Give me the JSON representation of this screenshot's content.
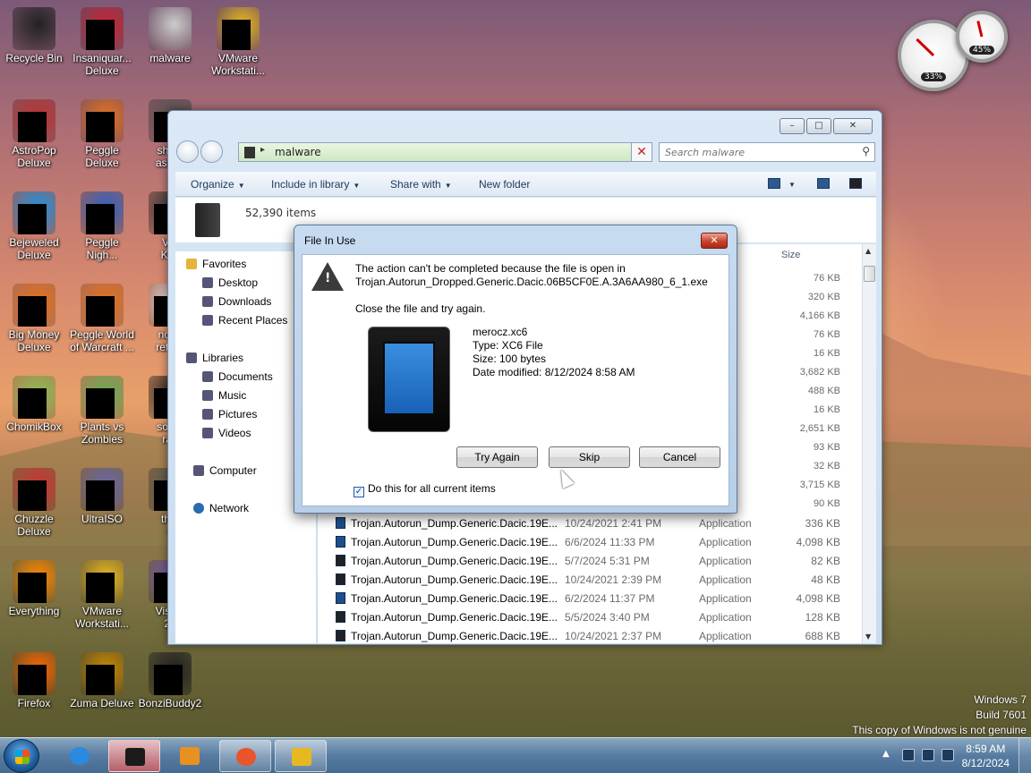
{
  "desktop": {
    "icons": [
      {
        "label": "Recycle Bin"
      },
      {
        "label": "Insaniquar...\nDeluxe"
      },
      {
        "label": "malware"
      },
      {
        "label": "VMware\nWorkstati..."
      },
      {
        "label": "AstroPop\nDeluxe"
      },
      {
        "label": "Peggle\nDeluxe"
      },
      {
        "label": "shit p\nasked"
      },
      {
        "label": "Bejeweled\nDeluxe"
      },
      {
        "label": "Peggle\nNigh..."
      },
      {
        "label": "VM\nKey"
      },
      {
        "label": "Big Money\nDeluxe"
      },
      {
        "label": "Peggle World\nof Warcraft ..."
      },
      {
        "label": "none\nretard"
      },
      {
        "label": "ChomikBox"
      },
      {
        "label": "Plants vs\nZombies"
      },
      {
        "label": "some\nran"
      },
      {
        "label": "Chuzzle\nDeluxe"
      },
      {
        "label": "UltraISO"
      },
      {
        "label": "that\nc"
      },
      {
        "label": "Everything"
      },
      {
        "label": "VMware\nWorkstati..."
      },
      {
        "label": "Visual\n20"
      },
      {
        "label": "Firefox"
      },
      {
        "label": "Zuma Deluxe"
      },
      {
        "label": "BonziBuddy2"
      }
    ]
  },
  "gadgets": {
    "cpu_label": "33%",
    "mem_label": "45%",
    "cpu": 33,
    "mem": 45
  },
  "explorer": {
    "address": "malware",
    "search_placeholder": "Search malware",
    "toolbar": {
      "organize": "Organize",
      "include": "Include in library",
      "share": "Share with",
      "new_folder": "New folder"
    },
    "item_count": "52,390 items",
    "nav": {
      "favorites": "Favorites",
      "desktop": "Desktop",
      "downloads": "Downloads",
      "recent": "Recent Places",
      "libraries": "Libraries",
      "documents": "Documents",
      "music": "Music",
      "pictures": "Pictures",
      "videos": "Videos",
      "computer": "Computer",
      "network": "Network"
    },
    "size_header": "Size",
    "sizes_above": [
      "76 KB",
      "320 KB",
      "4,166 KB",
      "76 KB",
      "16 KB",
      "3,682 KB",
      "488 KB",
      "16 KB",
      "2,651 KB",
      "93 KB",
      "32 KB",
      "3,715 KB",
      "90 KB"
    ],
    "rows": [
      {
        "name": "Trojan.Autorun_Dump.Generic.Dacic.19E...",
        "date": "10/24/2021 2:41 PM",
        "type": "Application",
        "size": "336 KB",
        "icon": "blue"
      },
      {
        "name": "Trojan.Autorun_Dump.Generic.Dacic.19E...",
        "date": "6/6/2024 11:33 PM",
        "type": "Application",
        "size": "4,098 KB",
        "icon": "blue"
      },
      {
        "name": "Trojan.Autorun_Dump.Generic.Dacic.19E...",
        "date": "5/7/2024 5:31 PM",
        "type": "Application",
        "size": "82 KB",
        "icon": "black"
      },
      {
        "name": "Trojan.Autorun_Dump.Generic.Dacic.19E...",
        "date": "10/24/2021 2:39 PM",
        "type": "Application",
        "size": "48 KB",
        "icon": "black"
      },
      {
        "name": "Trojan.Autorun_Dump.Generic.Dacic.19E...",
        "date": "6/2/2024 11:37 PM",
        "type": "Application",
        "size": "4,098 KB",
        "icon": "blue"
      },
      {
        "name": "Trojan.Autorun_Dump.Generic.Dacic.19E...",
        "date": "5/5/2024 3:40 PM",
        "type": "Application",
        "size": "128 KB",
        "icon": "black"
      },
      {
        "name": "Trojan.Autorun_Dump.Generic.Dacic.19E...",
        "date": "10/24/2021 2:37 PM",
        "type": "Application",
        "size": "688 KB",
        "icon": "black"
      }
    ]
  },
  "dialog": {
    "title": "File In Use",
    "message_line1": "The action can't be completed because the file is open in",
    "message_line2": "Trojan.Autorun_Dropped.Generic.Dacic.06B5CF0E.A.3A6AA980_6_1.exe",
    "message_hint": "Close the file and try again.",
    "file_name": "merocz.xc6",
    "file_type": "Type: XC6 File",
    "file_size": "Size: 100 bytes",
    "file_modified": "Date modified: 8/12/2024 8:58 AM",
    "btn_try": "Try Again",
    "btn_skip": "Skip",
    "btn_cancel": "Cancel",
    "checkbox_label": "Do this for all current items"
  },
  "watermark": {
    "line1": "Windows 7",
    "line2": "Build 7601",
    "line3": "This copy of Windows is not genuine"
  },
  "taskbar": {
    "time": "8:59 AM",
    "date": "8/12/2024"
  }
}
